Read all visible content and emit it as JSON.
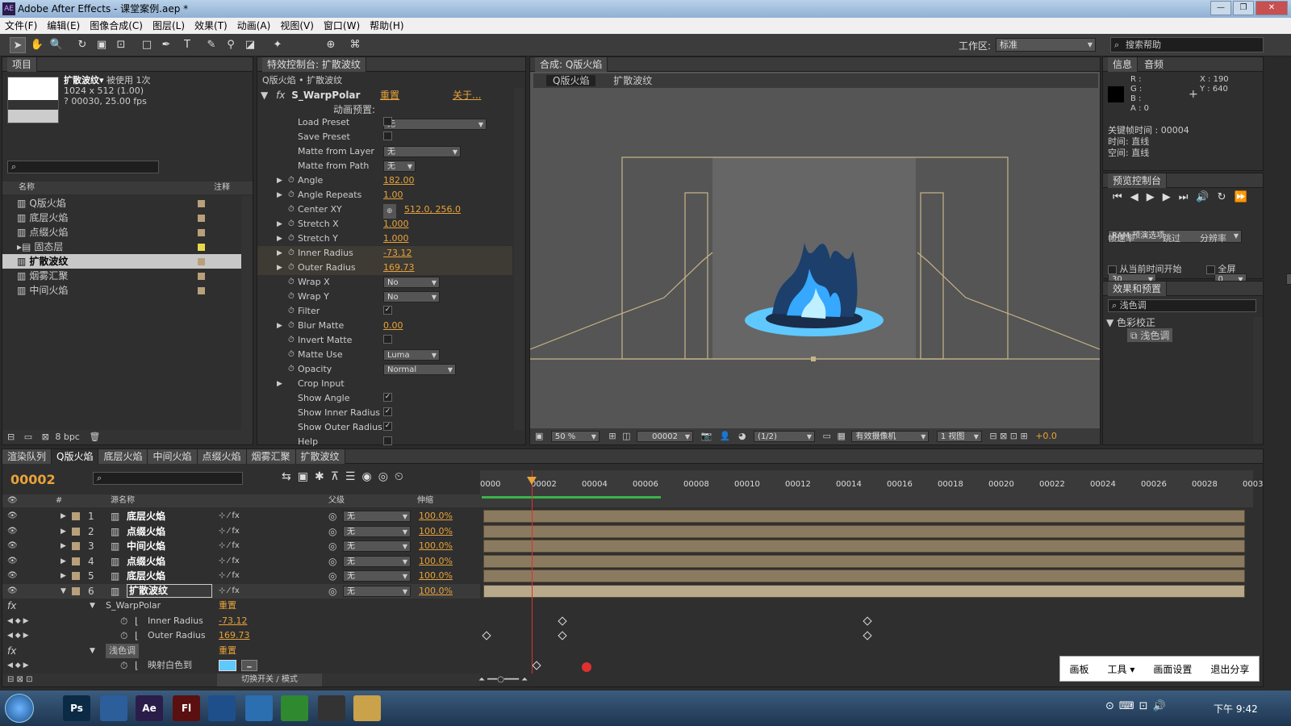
{
  "window": {
    "title": "Adobe After Effects - 课堂案例.aep *",
    "app_badge": "AE"
  },
  "menu": [
    "文件(F)",
    "编辑(E)",
    "图像合成(C)",
    "图层(L)",
    "效果(T)",
    "动画(A)",
    "视图(V)",
    "窗口(W)",
    "帮助(H)"
  ],
  "toolbar": {
    "workspace_label": "工作区:",
    "workspace_value": "标准",
    "search_placeholder": "搜索帮助"
  },
  "project": {
    "tab": "项目",
    "item_name": "扩散波纹▾",
    "used": "被使用 1次",
    "size": "1024 x 512 (1.00)",
    "duration": "? 00030, 25.00 fps",
    "col_name": "名称",
    "col_comment": "注释",
    "bpc": "8 bpc",
    "items": [
      "Q版火焰",
      "底层火焰",
      "点缀火焰",
      "固态层",
      "扩散波纹",
      "烟雾汇聚",
      "中间火焰"
    ]
  },
  "effects": {
    "tab": "特效控制台: 扩散波纹",
    "breadcrumb": "Q版火焰 • 扩散波纹",
    "effect_name": "S_WarpPolar",
    "reset": "重置",
    "about": "关于...",
    "preset_label": "动画预置:",
    "preset_value": "无",
    "props": [
      {
        "name": "Load Preset",
        "kind": "cb",
        "value": ""
      },
      {
        "name": "Save Preset",
        "kind": "cb",
        "value": ""
      },
      {
        "name": "Matte from Layer",
        "kind": "dd",
        "value": "无"
      },
      {
        "name": "Matte from Path",
        "kind": "dd",
        "value": "无"
      },
      {
        "name": "Angle",
        "kind": "num",
        "value": "182.00"
      },
      {
        "name": "Angle Repeats",
        "kind": "num",
        "value": "1.00"
      },
      {
        "name": "Center XY",
        "kind": "pt",
        "value": "512.0, 256.0"
      },
      {
        "name": "Stretch X",
        "kind": "num",
        "value": "1.000"
      },
      {
        "name": "Stretch Y",
        "kind": "num",
        "value": "1.000"
      },
      {
        "name": "Inner Radius",
        "kind": "num",
        "value": "-73.12"
      },
      {
        "name": "Outer Radius",
        "kind": "num",
        "value": "169.73"
      },
      {
        "name": "Wrap X",
        "kind": "dd",
        "value": "No"
      },
      {
        "name": "Wrap Y",
        "kind": "dd",
        "value": "No"
      },
      {
        "name": "Filter",
        "kind": "cb",
        "value": "✓"
      },
      {
        "name": "Blur Matte",
        "kind": "num",
        "value": "0.00"
      },
      {
        "name": "Invert Matte",
        "kind": "cb",
        "value": ""
      },
      {
        "name": "Matte Use",
        "kind": "dd",
        "value": "Luma"
      },
      {
        "name": "Opacity",
        "kind": "dd",
        "value": "Normal"
      },
      {
        "name": "Crop Input",
        "kind": "none",
        "value": ""
      },
      {
        "name": "Show Angle",
        "kind": "cb",
        "value": "✓"
      },
      {
        "name": "Show Inner Radius",
        "kind": "cb",
        "value": "✓"
      },
      {
        "name": "Show Outer Radius",
        "kind": "cb",
        "value": "✓"
      },
      {
        "name": "Help",
        "kind": "cb",
        "value": ""
      }
    ]
  },
  "comp": {
    "tab": "合成: Q版火焰",
    "crumb1": "Q版火焰",
    "crumb2": "扩散波纹",
    "zoom": "50 %",
    "time": "00002",
    "res": "(1/2)",
    "camera": "有效摄像机",
    "views": "1 视图",
    "offset": "+0.0"
  },
  "info": {
    "tab": "信息",
    "tab2": "音频",
    "r": "R :",
    "g": "G :",
    "b": "B :",
    "a": "A : 0",
    "x": "X : 190",
    "y": "Y : 640",
    "kf": "关键帧时间 : 00004",
    "t": "时间: 直线",
    "s": "空间: 直线"
  },
  "preview": {
    "tab": "预览控制台",
    "ram": "RAM 预演选项",
    "fps_label": "帧速率",
    "skip_label": "跳过",
    "res_label": "分辨率",
    "fps": "30",
    "skip": "0",
    "res": "自动",
    "from_current": "从当前时间开始",
    "full": "全屏"
  },
  "effpre": {
    "tab": "效果和预置",
    "search": "浅色调",
    "cat": "色彩校正",
    "item": "浅色调"
  },
  "timeline": {
    "tabs": [
      "渲染队列",
      "Q版火焰",
      "底层火焰",
      "中间火焰",
      "点缀火焰",
      "烟雾汇聚",
      "扩散波纹"
    ],
    "time": "00002",
    "col_src": "源名称",
    "col_parent": "父级",
    "col_stretch": "伸缩",
    "ticks": [
      "0000",
      "00002",
      "00004",
      "00006",
      "00008",
      "00010",
      "00012",
      "00014",
      "00016",
      "00018",
      "00020",
      "00022",
      "00024",
      "00026",
      "00028",
      "0003"
    ],
    "layers": [
      {
        "num": "1",
        "name": "底层火焰",
        "parent": "无",
        "stretch": "100.0%"
      },
      {
        "num": "2",
        "name": "点缀火焰",
        "parent": "无",
        "stretch": "100.0%"
      },
      {
        "num": "3",
        "name": "中间火焰",
        "parent": "无",
        "stretch": "100.0%"
      },
      {
        "num": "4",
        "name": "点缀火焰",
        "parent": "无",
        "stretch": "100.0%"
      },
      {
        "num": "5",
        "name": "底层火焰",
        "parent": "无",
        "stretch": "100.0%"
      },
      {
        "num": "6",
        "name": "扩散波纹",
        "parent": "无",
        "stretch": "100.0%"
      }
    ],
    "fx1": "S_WarpPolar",
    "fx1_reset": "重置",
    "inner": "Inner Radius",
    "inner_v": "-73.12",
    "outer": "Outer Radius",
    "outer_v": "169.73",
    "fx2": "浅色调",
    "fx2_reset": "重置",
    "map": "映射白色到",
    "switch": "切换开关 / 模式"
  },
  "share": [
    "画板",
    "工具 ▾",
    "画面设置",
    "退出分享"
  ],
  "taskbar": {
    "clock": "下午 9:42",
    "apps": [
      "Ps",
      "",
      "Ae",
      "Fl",
      "",
      "",
      "",
      "",
      ""
    ]
  }
}
